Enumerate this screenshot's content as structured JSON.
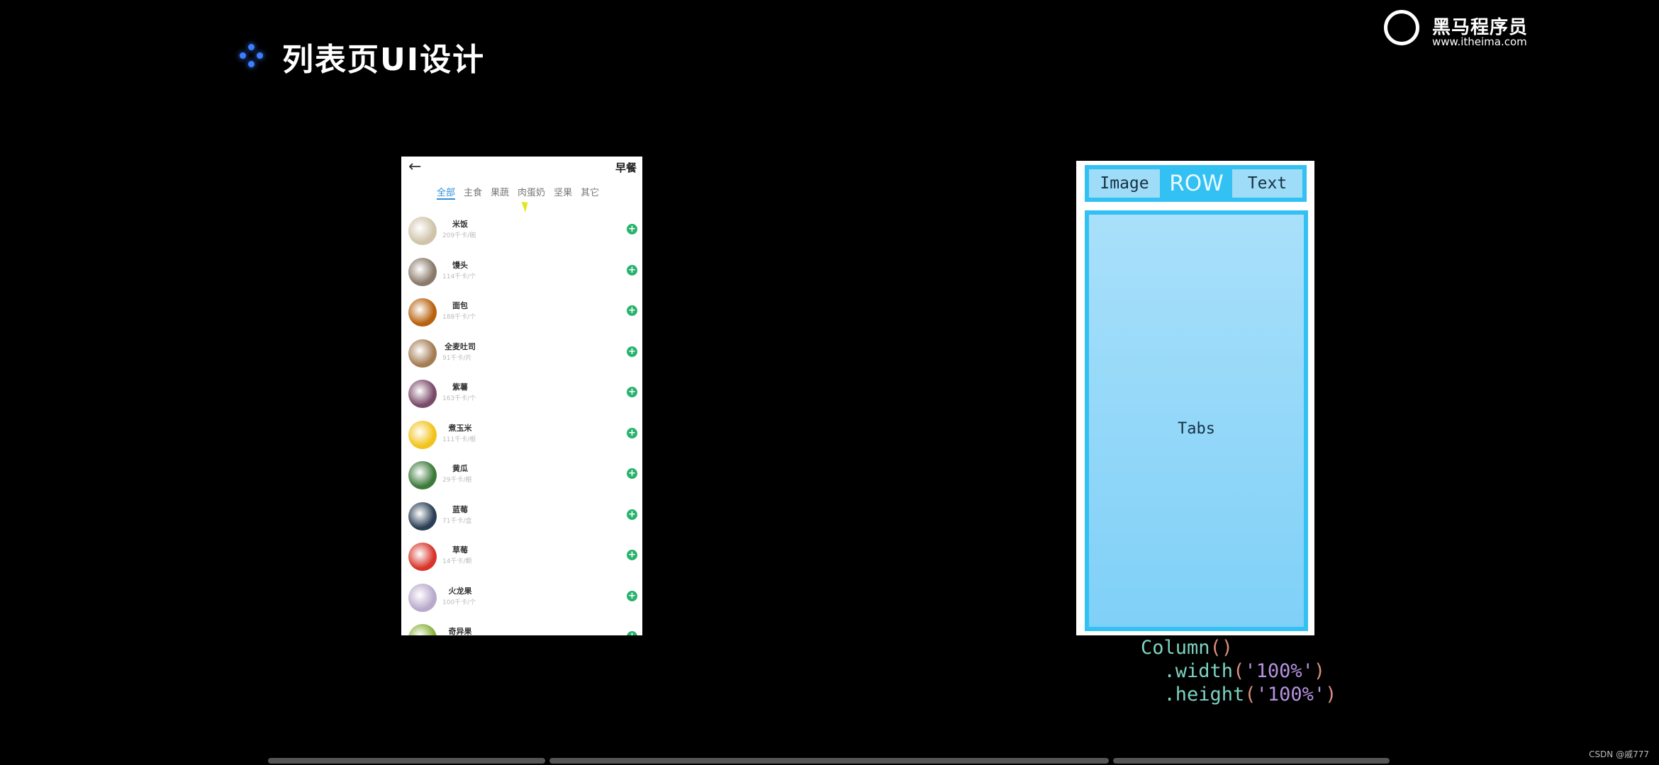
{
  "slide": {
    "title": "列表页UI设计",
    "icon": "sparkle-dots-icon"
  },
  "logo": {
    "name_cn": "黑马程序员",
    "url": "www.itheima.com"
  },
  "phone": {
    "back_icon": "arrow-left-icon",
    "title": "早餐",
    "tabs": [
      {
        "label": "全部",
        "active": true
      },
      {
        "label": "主食"
      },
      {
        "label": "果蔬"
      },
      {
        "label": "肉蛋奶"
      },
      {
        "label": "坚果"
      },
      {
        "label": "其它"
      }
    ],
    "accent": "#2f8fdc",
    "add_color": "#28b36c",
    "items": [
      {
        "name": "米饭",
        "cal": "209千卡/碗",
        "color": "#cfc3aa"
      },
      {
        "name": "馒头",
        "cal": "114千卡/个",
        "color": "#8a7a6a"
      },
      {
        "name": "面包",
        "cal": "188千卡/个",
        "color": "#b8620f"
      },
      {
        "name": "全麦吐司",
        "cal": "91千卡/片",
        "color": "#a47d55"
      },
      {
        "name": "紫薯",
        "cal": "163千卡/个",
        "color": "#7a4a6a"
      },
      {
        "name": "煮玉米",
        "cal": "111千卡/根",
        "color": "#f2c31a"
      },
      {
        "name": "黄瓜",
        "cal": "29千卡/根",
        "color": "#3c7a3a"
      },
      {
        "name": "蓝莓",
        "cal": "71千卡/盒",
        "color": "#2a3f55"
      },
      {
        "name": "草莓",
        "cal": "14千卡/颗",
        "color": "#d8342a"
      },
      {
        "name": "火龙果",
        "cal": "100千卡/个",
        "color": "#b9aacb"
      },
      {
        "name": "奇异果",
        "cal": "",
        "color": "#8ab13a"
      }
    ]
  },
  "diagram": {
    "image": "Image",
    "row": "ROW",
    "text": "Text",
    "tabs": "Tabs"
  },
  "code": {
    "l1": "Column",
    "l2a": ".width",
    "l2b": "'100%'",
    "l3a": ".height",
    "l3b": "'100%'",
    "open": "(",
    "close": ")",
    "empty": "()"
  },
  "watermark": "CSDN @戚777"
}
